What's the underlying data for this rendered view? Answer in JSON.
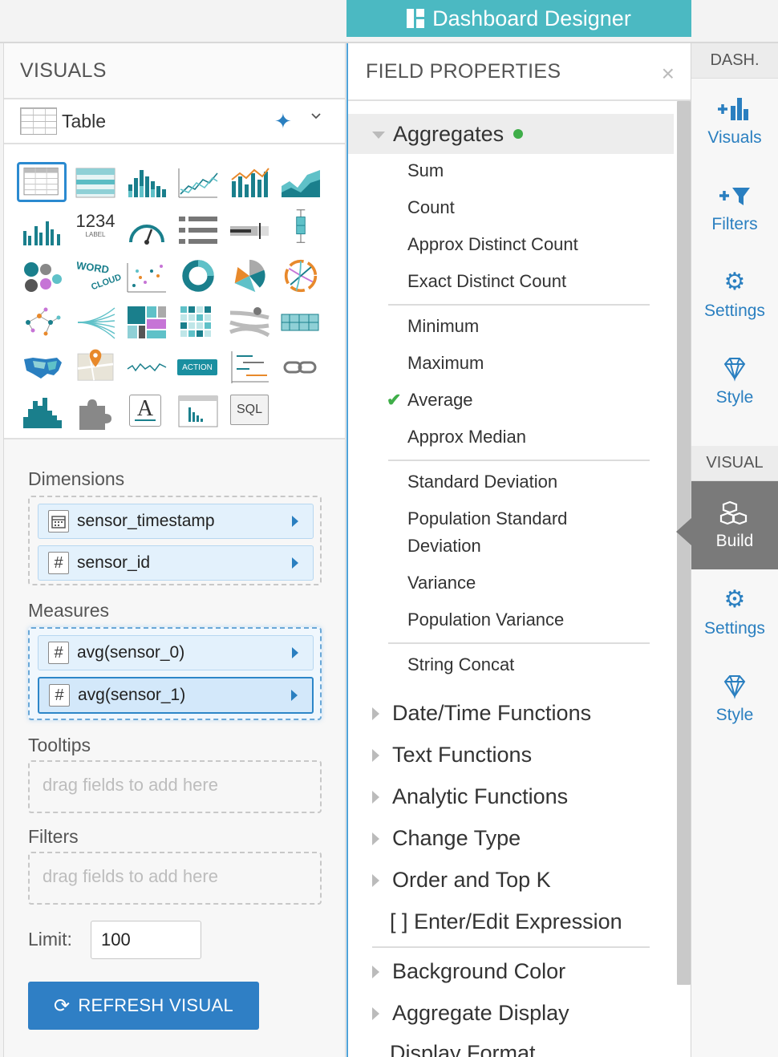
{
  "app": {
    "title": "Dashboard Designer"
  },
  "visuals_panel": {
    "header": "VISUALS",
    "selected_visual": "Table",
    "grid_icons": [
      "table-icon",
      "cross-tab-icon",
      "bar-chart-icon",
      "line-chart-icon",
      "combo-chart-icon",
      "area-chart-icon",
      "grouped-bars-icon",
      "kpi-icon",
      "gauge-icon",
      "list-icon",
      "bullet-icon",
      "box-plot-icon",
      "packed-bubbles-icon",
      "word-cloud-icon",
      "scatter-icon",
      "donut-icon",
      "radial-icon",
      "chord-icon",
      "network-icon",
      "sankey-icon",
      "tree-map-icon",
      "heat-map-icon",
      "flow-icon",
      "map-grid-icon",
      "us-map-icon",
      "interactive-map-icon",
      "sparkline-icon",
      "action-icon",
      "timeline-icon",
      "link-icon",
      "histogram-icon",
      "extension-icon",
      "rich-text-icon",
      "queries-icon",
      "sql-icon"
    ],
    "kpi_text": "1234",
    "kpi_sub": "LABEL",
    "word_cloud_text": "WORD",
    "word_cloud_text_2": "CLOUD",
    "action_text": "ACTION",
    "rich_text_glyph": "A",
    "sql_text": "SQL",
    "dimensions": {
      "label": "Dimensions",
      "fields": [
        {
          "name": "sensor_timestamp",
          "icon": "calendar-icon"
        },
        {
          "name": "sensor_id",
          "icon": "hash-icon",
          "glyph": "#"
        }
      ]
    },
    "measures": {
      "label": "Measures",
      "fields": [
        {
          "name": "avg(sensor_0)",
          "glyph": "#"
        },
        {
          "name": "avg(sensor_1)",
          "glyph": "#"
        }
      ]
    },
    "tooltips": {
      "label": "Tooltips",
      "placeholder": "drag fields to add here"
    },
    "filters": {
      "label": "Filters",
      "placeholder": "drag fields to add here"
    },
    "limit": {
      "label": "Limit:",
      "value": "100"
    },
    "refresh_button": "REFRESH VISUAL"
  },
  "field_properties": {
    "header": "FIELD PROPERTIES",
    "close_glyph": "×",
    "aggregates_label": "Aggregates",
    "aggregates": [
      [
        "Sum",
        "Count",
        "Approx Distinct Count",
        "Exact Distinct Count"
      ],
      [
        "Minimum",
        "Maximum",
        "Average",
        "Approx Median"
      ],
      [
        "Standard Deviation",
        "Population Standard",
        "Deviation",
        "Variance",
        "Population Variance"
      ],
      [
        "String Concat"
      ]
    ],
    "checked_item": "Average",
    "check_glyph": "✔",
    "sections": [
      "Date/Time Functions",
      "Text Functions",
      "Analytic Functions",
      "Change Type",
      "Order and Top K",
      "[ ] Enter/Edit Expression",
      "Background Color",
      "Aggregate Display",
      "Display Format"
    ]
  },
  "right_nav": {
    "dash_header": "DASH.",
    "visual_header": "VISUAL",
    "dash_items": [
      "Visuals",
      "Filters",
      "Settings",
      "Style"
    ],
    "visual_items": [
      "Build",
      "Settings",
      "Style"
    ]
  },
  "colors": {
    "banner": "#4bb9c2",
    "accent": "#2a7fc0",
    "check": "#3fae49",
    "build_bg": "#7a7a7a"
  }
}
